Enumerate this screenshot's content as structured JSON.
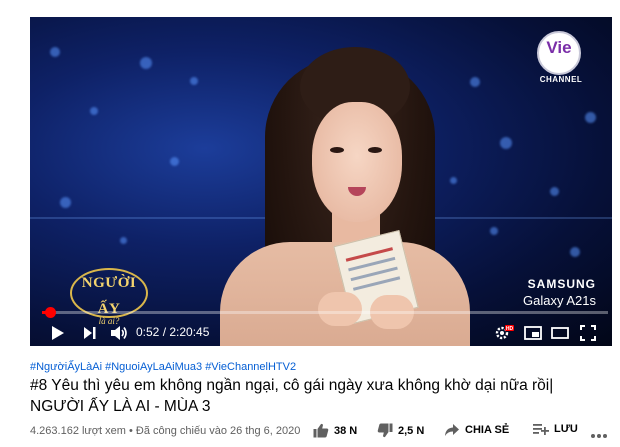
{
  "video": {
    "channel_logo_text": "Vie",
    "channel_logo_sub": "CHANNEL",
    "show_logo_line1": "NGƯỜI ẤY",
    "show_logo_line2": "là ai?",
    "sponsor_brand": "SAMSUNG",
    "sponsor_model": "Galaxy A21s",
    "time_current": "0:52",
    "time_total": "2:20:45",
    "time_display": "0:52 / 2:20:45",
    "progress_fraction": 0.0062
  },
  "controls": {
    "play_icon": "play-icon",
    "next_icon": "next-icon",
    "volume_icon": "volume-icon",
    "settings_icon": "settings-icon",
    "settings_badge": "HD",
    "miniplayer_icon": "miniplayer-icon",
    "theater_icon": "theater-icon",
    "fullscreen_icon": "fullscreen-icon"
  },
  "info": {
    "hashtags": "#NgườiẤyLàAi #NguoiAyLaAiMua3 #VieChannelHTV2",
    "title": "#8 Yêu thì yêu em không ngần ngại, cô gái ngày xưa không khờ dại nữa rồi| NGƯỜI ẤY LÀ AI - MÙA 3",
    "views_date": "4.263.162 lượt xem • Đã công chiếu vào 26 thg 6, 2020"
  },
  "actions": {
    "like_count": "38 N",
    "dislike_count": "2,5 N",
    "share_label": "CHIA SẺ",
    "save_label": "LƯU"
  },
  "colors": {
    "accent_red": "#ff0000",
    "link_blue": "#065fd4",
    "text_primary": "#030303",
    "text_secondary": "#606060"
  }
}
